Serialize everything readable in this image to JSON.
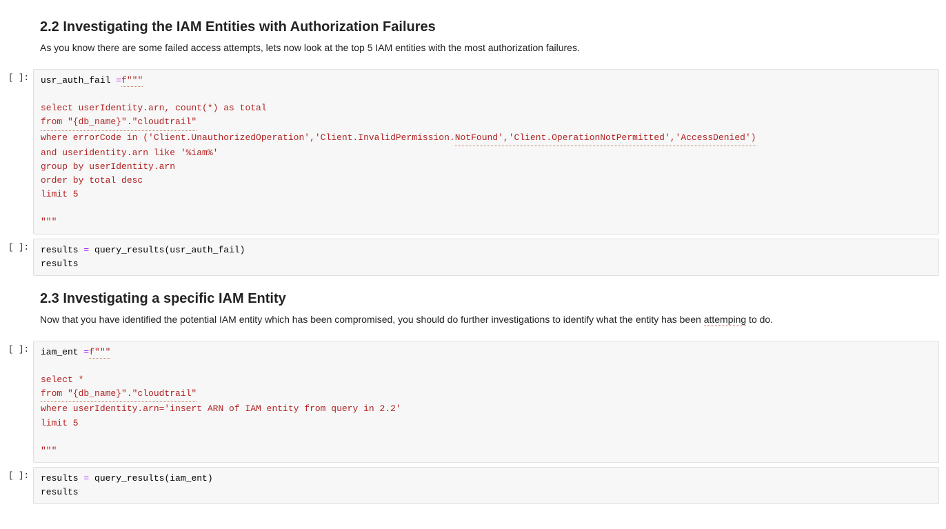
{
  "sections": {
    "s22": {
      "heading": "2.2 Investigating the IAM Entities with Authorization Failures",
      "para": "As you know there are some failed access attempts, lets now look at the top 5 IAM entities with the most authorization failures."
    },
    "s23": {
      "heading": "2.3 Investigating a specific IAM Entity",
      "para": "Now that you have identified the potential IAM entity which has been compromised, you should do further investigations to identify what the entity has been attemping to do."
    }
  },
  "prompt_label": "[ ]:",
  "code": {
    "cell1": {
      "assign_var": "usr_auth_fail ",
      "assign_op": "=",
      "fprefix": "f",
      "triple_open": "\"\"\"",
      "l1": "select userIdentity.arn, count(*) as total",
      "l2a": "from \"{db_name}\".\"cloudtrail\"",
      "l3a": "where errorCode in ('Client.UnauthorizedOperation','Client.InvalidPermission.",
      "l3b": "NotFound','Client.OperationNotPermitted','AccessDenied')",
      "l4": "and useridentity.arn like '%iam%'",
      "l5": "group by userIdentity.arn",
      "l6": "order by total desc",
      "l7": "limit 5",
      "triple_close": "\"\"\""
    },
    "cell2": {
      "line1_a": "results ",
      "line1_op": "=",
      "line1_b": " query_results(usr_auth_fail)",
      "line2": "results"
    },
    "cell3": {
      "assign_var": "iam_ent ",
      "assign_op": "=",
      "fprefix": "f",
      "triple_open": "\"\"\"",
      "l1": "select *",
      "l2a": "from \"{db_name}\".\"cloudtrail\"",
      "l3": "where userIdentity.arn='insert ARN of IAM entity from query in 2.2'",
      "l4": "limit 5",
      "triple_close": "\"\"\""
    },
    "cell4": {
      "line1_a": "results ",
      "line1_op": "=",
      "line1_b": " query_results(iam_ent)",
      "line2": "results"
    }
  }
}
